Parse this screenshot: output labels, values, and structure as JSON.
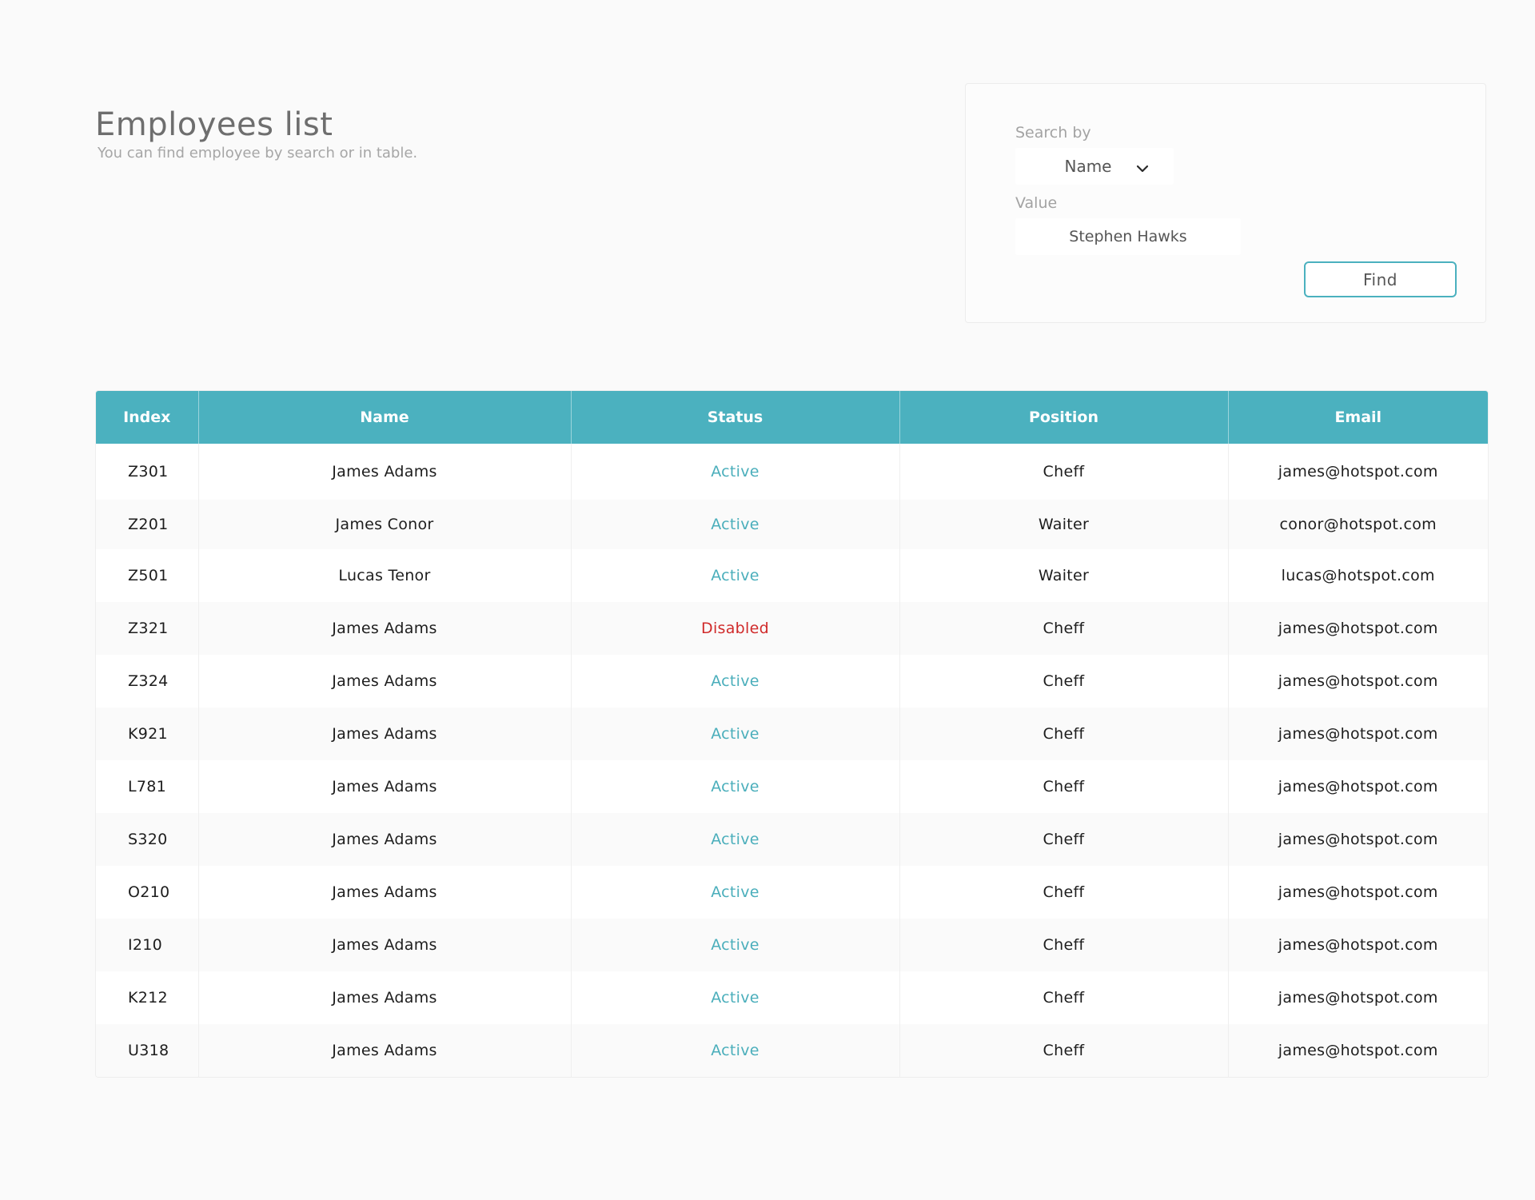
{
  "header": {
    "title": "Employees list",
    "subtitle": "You can find employee by search or in table."
  },
  "search": {
    "search_by_label": "Search by",
    "search_by_value": "Name",
    "value_label": "Value",
    "value": "Stephen Hawks",
    "find_label": "Find",
    "chevron_icon": "chevron-down-icon"
  },
  "table": {
    "columns": [
      "Index",
      "Name",
      "Status",
      "Position",
      "Email"
    ],
    "rows": [
      {
        "index": "Z301",
        "name": "James Adams",
        "status": "Active",
        "position": "Cheff",
        "email": "james@hotspot.com"
      },
      {
        "index": "Z201",
        "name": "James Conor",
        "status": "Active",
        "position": "Waiter",
        "email": "conor@hotspot.com"
      },
      {
        "index": "Z501",
        "name": "Lucas Tenor",
        "status": "Active",
        "position": "Waiter",
        "email": "lucas@hotspot.com"
      },
      {
        "index": "Z321",
        "name": "James Adams",
        "status": "Disabled",
        "position": "Cheff",
        "email": "james@hotspot.com"
      },
      {
        "index": "Z324",
        "name": "James Adams",
        "status": "Active",
        "position": "Cheff",
        "email": "james@hotspot.com"
      },
      {
        "index": "K921",
        "name": "James Adams",
        "status": "Active",
        "position": "Cheff",
        "email": "james@hotspot.com"
      },
      {
        "index": "L781",
        "name": "James Adams",
        "status": "Active",
        "position": "Cheff",
        "email": "james@hotspot.com"
      },
      {
        "index": "S320",
        "name": "James Adams",
        "status": "Active",
        "position": "Cheff",
        "email": "james@hotspot.com"
      },
      {
        "index": "O210",
        "name": "James Adams",
        "status": "Active",
        "position": "Cheff",
        "email": "james@hotspot.com"
      },
      {
        "index": "I210",
        "name": "James Adams",
        "status": "Active",
        "position": "Cheff",
        "email": "james@hotspot.com"
      },
      {
        "index": "K212",
        "name": "James Adams",
        "status": "Active",
        "position": "Cheff",
        "email": "james@hotspot.com"
      },
      {
        "index": "U318",
        "name": "James Adams",
        "status": "Active",
        "position": "Cheff",
        "email": "james@hotspot.com"
      }
    ]
  },
  "colors": {
    "accent": "#4bb1bf",
    "status_active": "#4aaebb",
    "status_disabled": "#d02a2a",
    "background": "#fafafa"
  }
}
